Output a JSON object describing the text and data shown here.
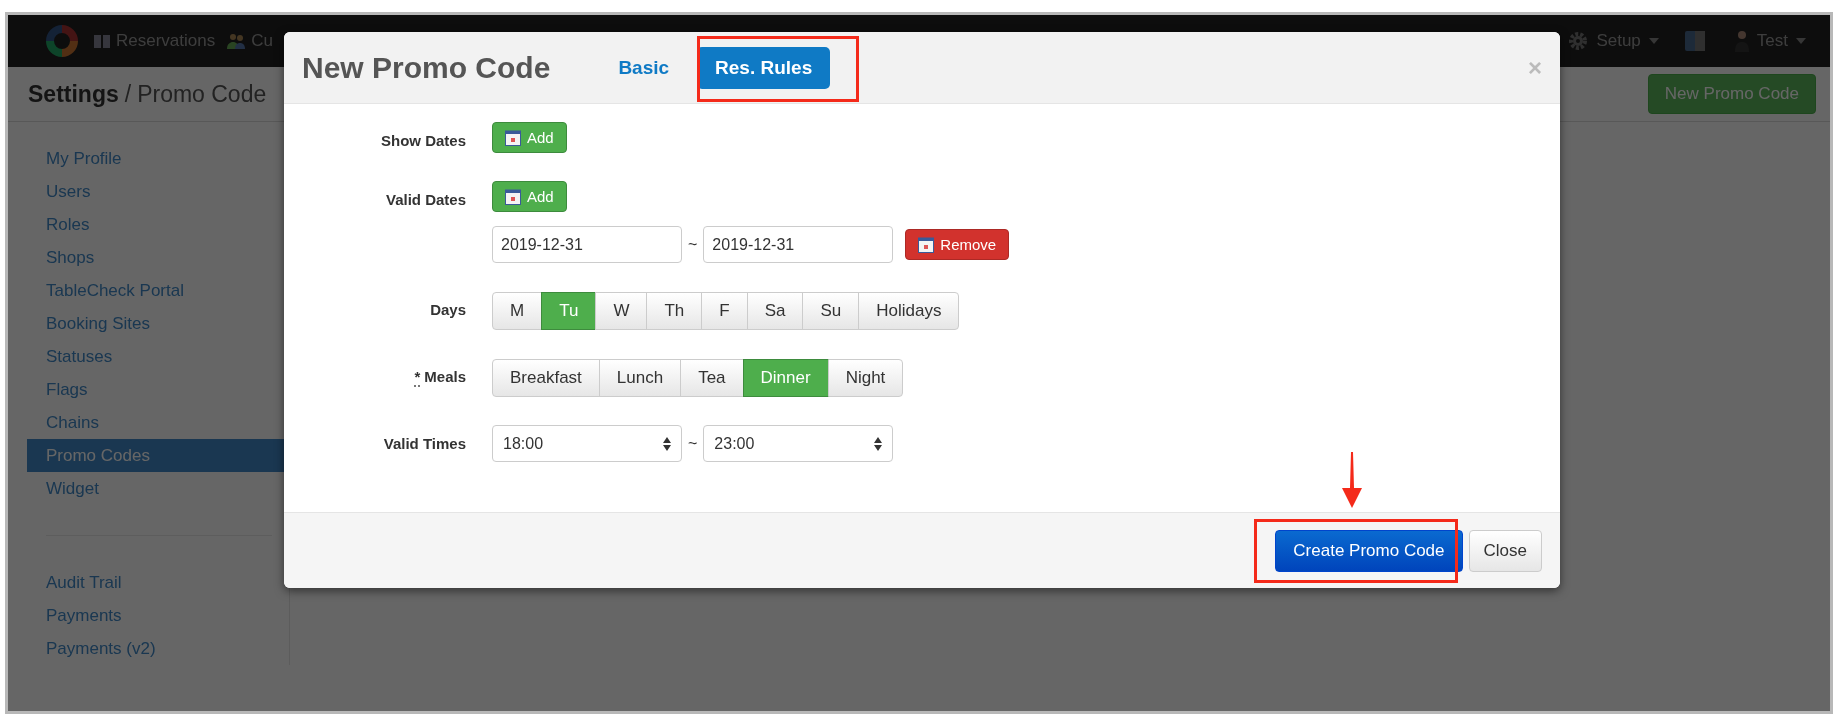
{
  "navbar": {
    "items": [
      {
        "label": "Reservations"
      },
      {
        "label": "Cu"
      }
    ],
    "setup": "Setup",
    "user": "Test"
  },
  "page": {
    "title": "Settings",
    "separator": "/",
    "subtitle": "Promo Code",
    "new_button": "New Promo Code"
  },
  "sidebar": {
    "groups": [
      [
        {
          "label": "My Profile",
          "selected": false
        },
        {
          "label": "Users",
          "selected": false
        },
        {
          "label": "Roles",
          "selected": false
        },
        {
          "label": "Shops",
          "selected": false
        },
        {
          "label": "TableCheck Portal",
          "selected": false
        },
        {
          "label": "Booking Sites",
          "selected": false
        },
        {
          "label": "Statuses",
          "selected": false
        },
        {
          "label": "Flags",
          "selected": false
        },
        {
          "label": "Chains",
          "selected": false
        },
        {
          "label": "Promo Codes",
          "selected": true
        },
        {
          "label": "Widget",
          "selected": false
        }
      ],
      [
        {
          "label": "Audit Trail",
          "selected": false
        },
        {
          "label": "Payments",
          "selected": false
        },
        {
          "label": "Payments (v2)",
          "selected": false
        }
      ]
    ]
  },
  "modal": {
    "title": "New Promo Code",
    "close": "×",
    "tabs": [
      {
        "label": "Basic",
        "selected": false
      },
      {
        "label": "Res. Rules",
        "selected": true
      }
    ],
    "rows": [
      {
        "kind": "add",
        "label": "Show Dates",
        "button": "Add"
      },
      {
        "kind": "dates",
        "label": "Valid Dates",
        "button": "Add",
        "ranges": [
          {
            "from": "2019-12-31",
            "separator": "~",
            "to": "2019-12-31",
            "remove": "Remove"
          }
        ]
      },
      {
        "kind": "toggles",
        "label": "Days",
        "options": [
          {
            "label": "M",
            "selected": false
          },
          {
            "label": "Tu",
            "selected": true
          },
          {
            "label": "W",
            "selected": false
          },
          {
            "label": "Th",
            "selected": false
          },
          {
            "label": "F",
            "selected": false
          },
          {
            "label": "Sa",
            "selected": false
          },
          {
            "label": "Su",
            "selected": false
          },
          {
            "label": "Holidays",
            "selected": false
          }
        ]
      },
      {
        "kind": "toggles",
        "label": "Meals",
        "required_mark": "*",
        "options": [
          {
            "label": "Breakfast",
            "selected": false
          },
          {
            "label": "Lunch",
            "selected": false
          },
          {
            "label": "Tea",
            "selected": false
          },
          {
            "label": "Dinner",
            "selected": true
          },
          {
            "label": "Night",
            "selected": false
          }
        ]
      },
      {
        "kind": "times",
        "label": "Valid Times",
        "from": "18:00",
        "separator": "~",
        "to": "23:00"
      }
    ],
    "footer": {
      "primary": "Create Promo Code",
      "secondary": "Close"
    }
  }
}
